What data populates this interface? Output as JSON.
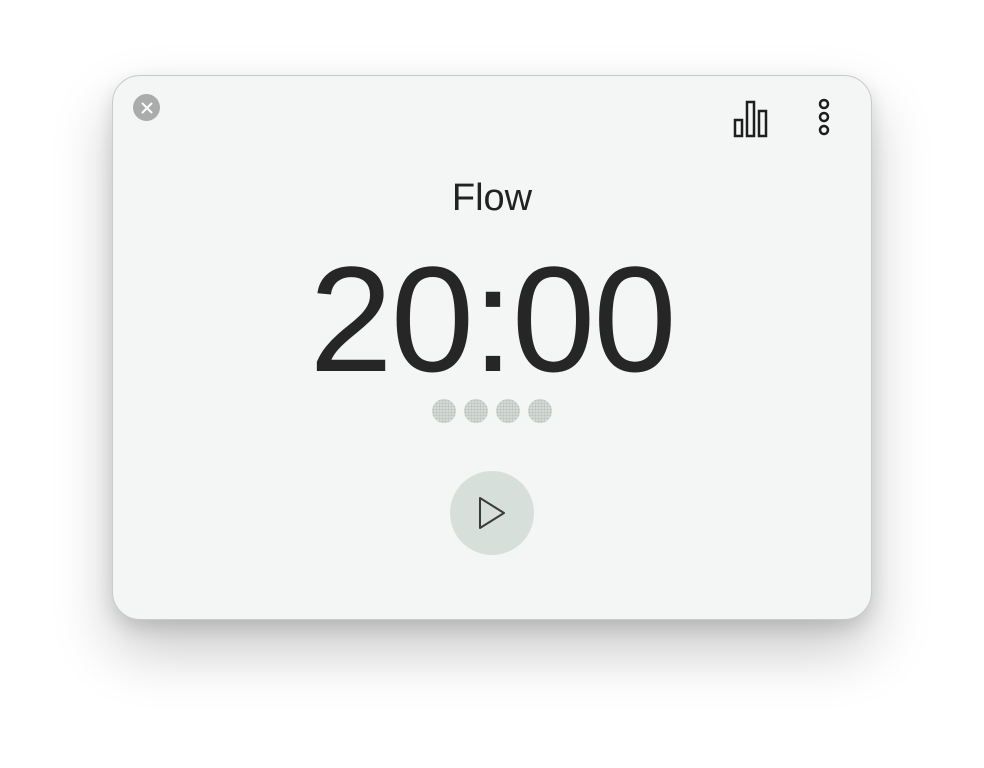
{
  "app": {
    "mode_title": "Flow",
    "timer_display": "20:00",
    "session_dots": [
      {
        "state": "pending"
      },
      {
        "state": "pending"
      },
      {
        "state": "pending"
      },
      {
        "state": "pending"
      }
    ]
  },
  "toolbar": {
    "close_icon": "close-icon",
    "stats_icon": "bar-chart-icon",
    "menu_icon": "more-vertical-icon"
  },
  "controls": {
    "play_icon": "play-icon"
  },
  "colors": {
    "window_bg": "#f4f6f5",
    "text": "#262626",
    "close_button": "#a9acab",
    "play_button_bg": "#d7dfdb",
    "dot": "#d3d8d5"
  }
}
